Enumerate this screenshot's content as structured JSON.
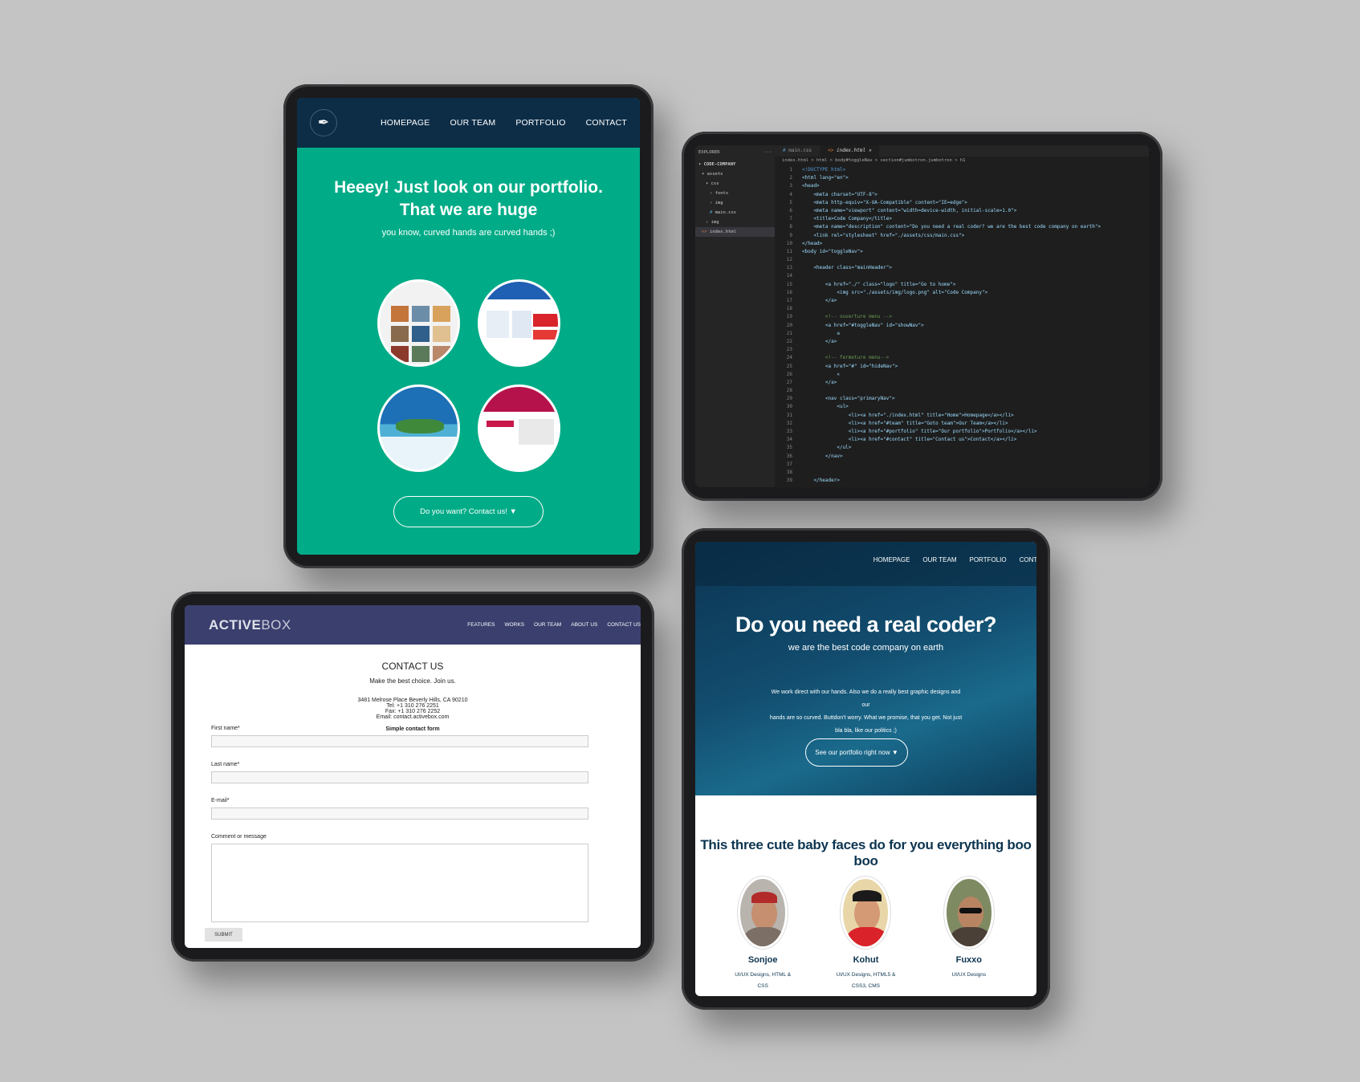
{
  "portfolio": {
    "nav": [
      "HOMEPAGE",
      "OUR TEAM",
      "PORTFOLIO",
      "CONTACT"
    ],
    "title_line1": "Heeey! Just look on our portfolio.",
    "title_line2": "That we are huge",
    "subtitle": "you know, curved hands are curved hands ;)",
    "cta": "Do you want? Contact us! ▼"
  },
  "editor": {
    "explorer_label": "EXPLORER",
    "tabs": [
      "main.css",
      "index.html"
    ],
    "breadcrumb": "index.html > html > body#toggleNav > section#jumbotron.jumbotron > h1",
    "tree": [
      "CODE-COMPANY",
      "assets",
      "css",
      "fonts",
      "img",
      "main.css",
      "img",
      "index.html"
    ],
    "lines": [
      "<!DOCTYPE html>",
      "<html lang=\"en\">",
      "<head>",
      "    <meta charset=\"UTF-8\">",
      "    <meta http-equiv=\"X-UA-Compatible\" content=\"IE=edge\">",
      "    <meta name=\"viewport\" content=\"width=device-width, initial-scale=1.0\">",
      "    <title>Code Company</title>",
      "    <meta name=\"description\" content=\"Do you need a real coder? we are the best code company on earth\">",
      "    <link rel=\"stylesheet\" href=\"./assets/css/main.css\">",
      "</head>",
      "<body id=\"toggleNav\">",
      "",
      "    <header class=\"mainHeader\">",
      "",
      "        <a href=\"./\" class=\"logo\" title=\"Go to home\">",
      "            <img src=\"./assets/img/logo.png\" alt=\"Code Company\">",
      "        </a>",
      "",
      "        <!-- ouverture menu -->",
      "        <a href=\"#toggleNav\" id=\"showNav\">",
      "            ≡",
      "        </a>",
      "",
      "        <!-- fermeture menu-->",
      "        <a href=\"#\" id=\"hideNav\">",
      "            ✕",
      "        </a>",
      "",
      "        <nav class=\"primaryNav\">",
      "            <ul>",
      "                <li><a href=\"./index.html\" title=\"Home\">Homepage</a></li>",
      "                <li><a href=\"#team\" title=\"Goto team\">Our Team</a></li>",
      "                <li><a href=\"#portfolio\" title=\"Our portfolio\">Portfolio</a></li>",
      "                <li><a href=\"#contact\" title=\"Contact us\">Contact</a></li>",
      "            </ul>",
      "        </nav>",
      "",
      "",
      "    </header>"
    ]
  },
  "contact": {
    "logo_a": "ACTIVE",
    "logo_b": "BOX",
    "nav": [
      "FEATURES",
      "WORKS",
      "OUR TEAM",
      "ABOUT US",
      "CONTACT US"
    ],
    "title": "CONTACT US",
    "subtitle": "Make the best choice. Join us.",
    "address": "3481 Melrose Place Beverly Hills, CA 90210",
    "tel": "Tel: +1 310 276 2251",
    "fax": "Fax: +1 310 276 2252",
    "email": "Email: contact.activebox.com",
    "form_title": "Simple contact form",
    "first_name": "First name*",
    "last_name": "Last name*",
    "email_label": "E-mail*",
    "comment": "Comment or message",
    "submit": "SUBMIT"
  },
  "coder": {
    "nav": [
      "HOMEPAGE",
      "OUR TEAM",
      "PORTFOLIO",
      "CONTA"
    ],
    "title": "Do you need a real coder?",
    "subtitle": "we are the best code company on earth",
    "para_1": "We work direct with our hands. Also we do a really best graphic designs and our",
    "para_2": "hands are so curved. Buttdon't worry. What we promise, that you get. Not just",
    "para_3": "bla bla, like our politics ;)",
    "cta": "See our portfolio right now ▼",
    "team_title": "This three cute baby faces do for you everything boo boo",
    "team": [
      {
        "name": "Sonjoe",
        "role_1": "UI/UX Designs, HTML &",
        "role_2": "CSS"
      },
      {
        "name": "Kohut",
        "role_1": "UI/UX Designs, HTML5 &",
        "role_2": "CSS3, CMS"
      },
      {
        "name": "Fuxxo",
        "role_1": "UI/UX Designs",
        "role_2": ""
      }
    ]
  }
}
